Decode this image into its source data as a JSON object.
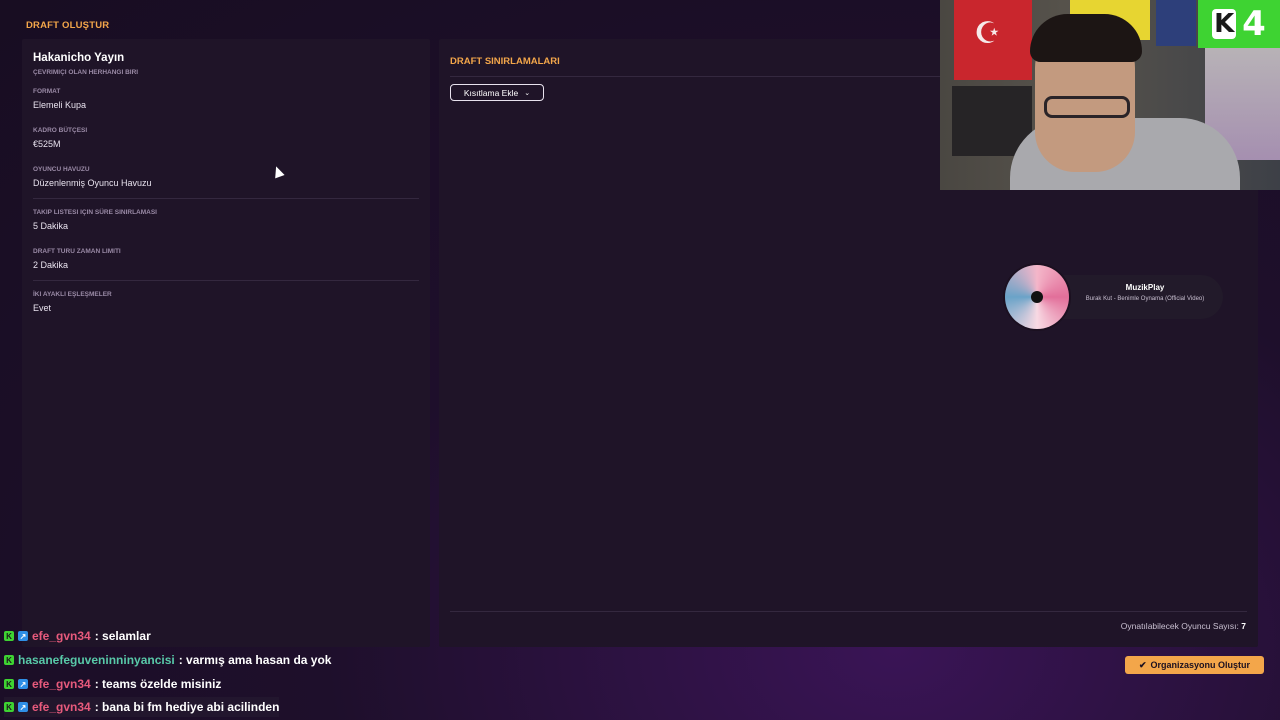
{
  "page": {
    "title": "DRAFT OLUŞTUR"
  },
  "left_panel": {
    "host_name": "Hakanicho Yayın",
    "host_subtitle": "ÇEVRIMIÇI OLAN HERHANGI BIRI",
    "fields": [
      {
        "label": "FORMAT",
        "value": "Elemeli Kupa"
      },
      {
        "label": "KADRO BÜTÇESI",
        "value": "€525M"
      },
      {
        "label": "OYUNCU HAVUZU",
        "value": "Düzenlenmiş Oyuncu Havuzu"
      },
      {
        "label": "TAKIP LISTESI IÇIN SÜRE SINIRLAMASI",
        "value": "5 Dakika"
      },
      {
        "label": "DRAFT TURU ZAMAN LIMITI",
        "value": "2 Dakika"
      },
      {
        "label": "İKI AYAKLI EŞLEŞMELER",
        "value": "Evet"
      }
    ]
  },
  "right_panel": {
    "section_title": "DRAFT SINIRLAMALARI",
    "add_restriction_label": "Kısıtlama Ekle",
    "player_count_label": "Oynatılabilecek Oyuncu Sayısı:",
    "player_count_value": "7"
  },
  "actions": {
    "create_org_label": "Organizasyonu Oluştur"
  },
  "overlay": {
    "webcam_logo": "4",
    "music_player": {
      "title": "MuzikPlay",
      "track": "Burak Kut - Benimle Oynama (Official Video)"
    }
  },
  "chat": [
    {
      "user": "efe_gvn34",
      "message": ": selamlar",
      "badges": [
        "k",
        "b"
      ],
      "user_color": "pink"
    },
    {
      "user": "hasanefeguveninninyancisi",
      "message": ": varmış ama hasan da yok",
      "badges": [
        "k"
      ],
      "user_color": "green"
    },
    {
      "user": "efe_gvn34",
      "message": ": teams özelde misiniz",
      "badges": [
        "k",
        "b"
      ],
      "user_color": "pink"
    },
    {
      "user": "efe_gvn34",
      "message": ": bana bi fm hediye abi acilinden",
      "badges": [
        "k",
        "b"
      ],
      "user_color": "pink"
    }
  ],
  "colors": {
    "accent": "#f3a64a",
    "panel": "#1f1428",
    "background": "#180d22"
  }
}
